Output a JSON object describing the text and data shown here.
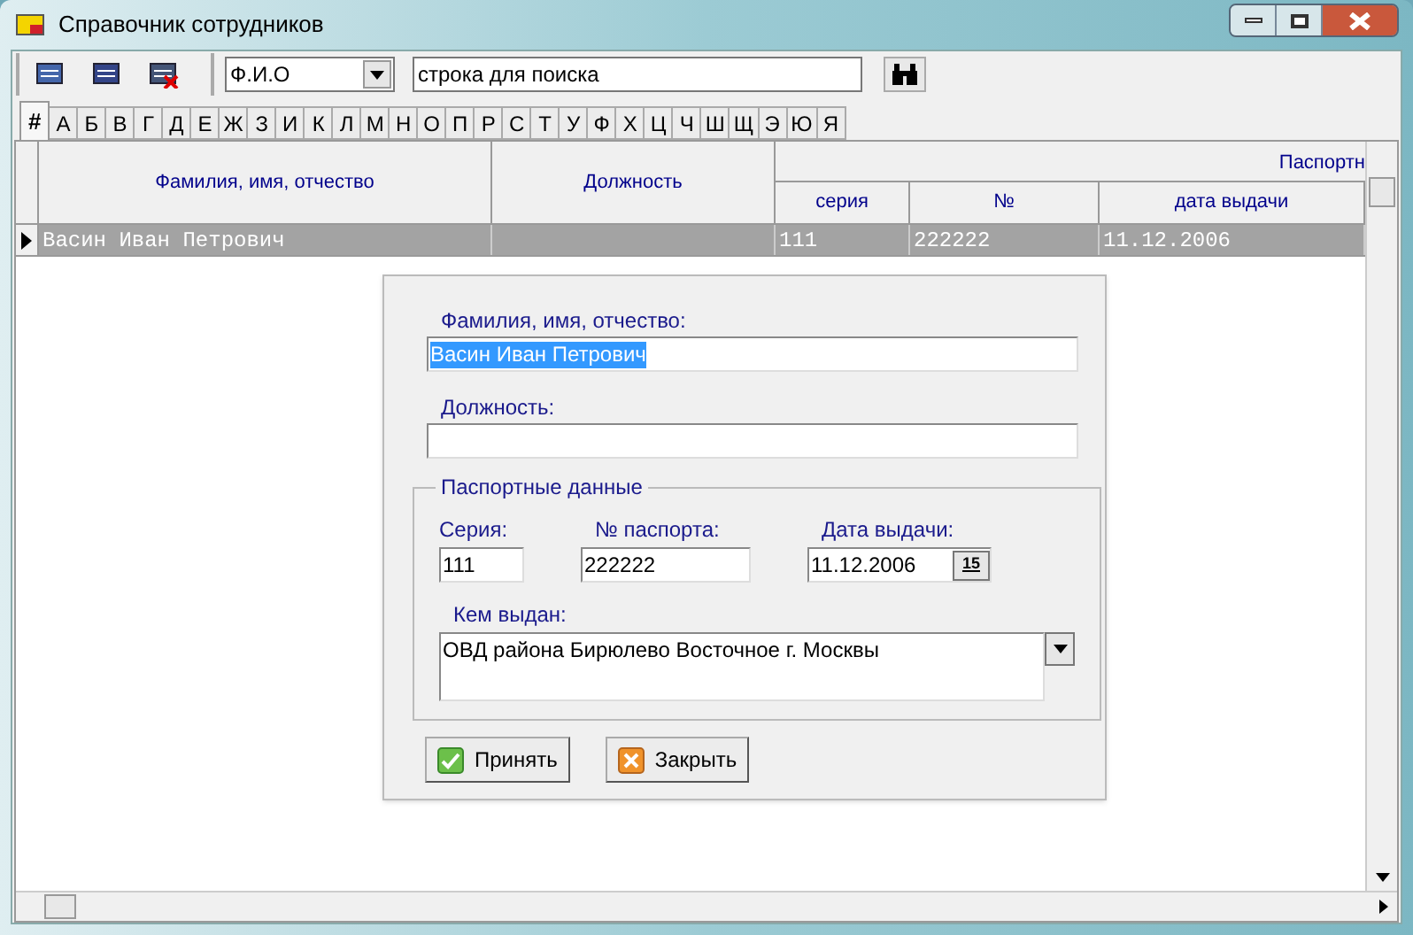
{
  "window": {
    "title": "Справочник сотрудников"
  },
  "toolbar": {
    "search_field": {
      "selected_option": "Ф.И.О"
    },
    "search_text": {
      "value": "строка для поиска"
    }
  },
  "letter_tabs": [
    {
      "label": "#",
      "selected": true
    },
    {
      "label": "А",
      "selected": false
    },
    {
      "label": "Б",
      "selected": false
    },
    {
      "label": "В",
      "selected": false
    },
    {
      "label": "Г",
      "selected": false
    },
    {
      "label": "Д",
      "selected": false
    },
    {
      "label": "Е",
      "selected": false
    },
    {
      "label": "Ж",
      "selected": false
    },
    {
      "label": "З",
      "selected": false
    },
    {
      "label": "И",
      "selected": false
    },
    {
      "label": "К",
      "selected": false
    },
    {
      "label": "Л",
      "selected": false
    },
    {
      "label": "М",
      "selected": false
    },
    {
      "label": "Н",
      "selected": false
    },
    {
      "label": "О",
      "selected": false
    },
    {
      "label": "П",
      "selected": false
    },
    {
      "label": "Р",
      "selected": false
    },
    {
      "label": "С",
      "selected": false
    },
    {
      "label": "Т",
      "selected": false
    },
    {
      "label": "У",
      "selected": false
    },
    {
      "label": "Ф",
      "selected": false
    },
    {
      "label": "Х",
      "selected": false
    },
    {
      "label": "Ц",
      "selected": false
    },
    {
      "label": "Ч",
      "selected": false
    },
    {
      "label": "Ш",
      "selected": false
    },
    {
      "label": "Щ",
      "selected": false
    },
    {
      "label": "Э",
      "selected": false
    },
    {
      "label": "Ю",
      "selected": false
    },
    {
      "label": "Я",
      "selected": false
    }
  ],
  "table": {
    "columns": [
      "Фамилия, имя, отчество",
      "Должность"
    ],
    "group_header": "Паспортн",
    "group_columns": [
      "серия",
      "№",
      "дата выдачи"
    ],
    "rows": [
      {
        "selected": true,
        "cells": [
          "Васин Иван Петрович",
          "",
          "111",
          "222222",
          "11.12.2006"
        ]
      }
    ]
  },
  "dialog": {
    "name_label": "Фамилия, имя, отчество:",
    "name_value": "Васин Иван Петрович",
    "position_label": "Должность:",
    "passport_group": "Паспортные данные",
    "series_label": "Серия:",
    "series_value": "111",
    "number_label": "№ паспорта:",
    "number_value": "222222",
    "date_label": "Дата выдачи:",
    "date_value": "11.12.2006",
    "calendar_button": "15",
    "issued_label": "Кем выдан:",
    "issued_value": "ОВД района Бирюлево Восточное г. Москвы",
    "buttons": [
      {
        "kind": "accept",
        "label": "Принять"
      },
      {
        "kind": "close",
        "label": "Закрыть"
      }
    ]
  }
}
